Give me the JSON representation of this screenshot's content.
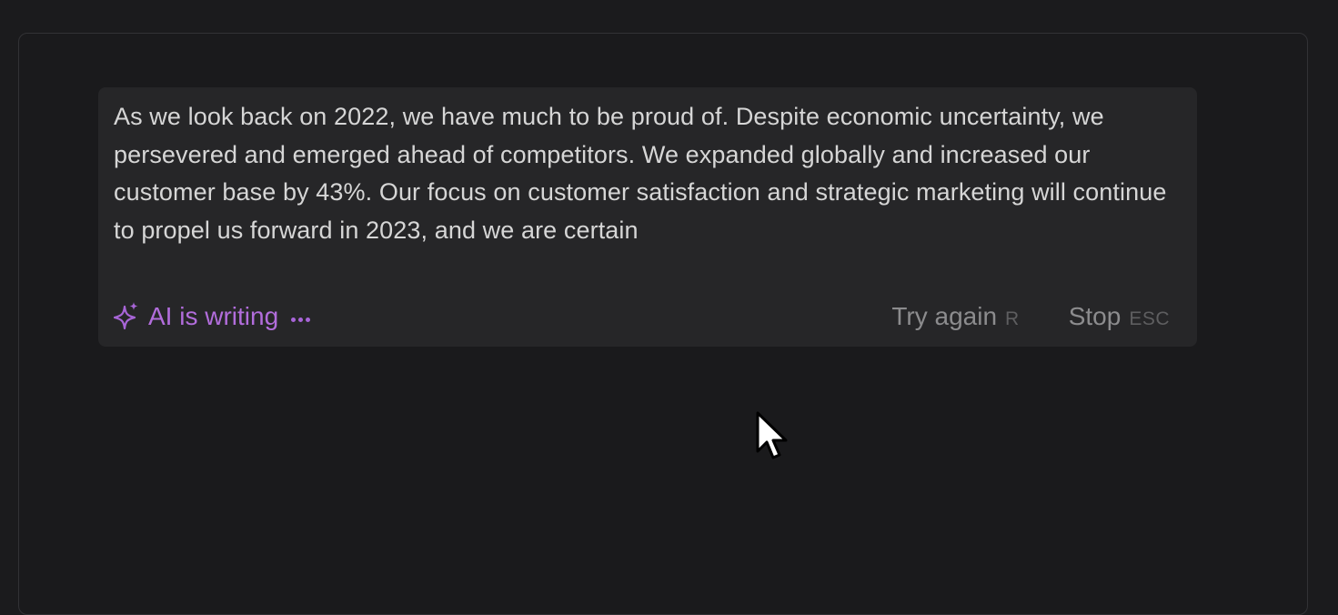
{
  "ai_block": {
    "generated_text": "As we look back on 2022, we have much to be proud of. Despite economic uncertainty, we persevered and emerged ahead of competitors. We expanded globally and increased our customer base by 43%. Our focus on customer satisfaction and strategic marketing will continue to propel us forward in 2023, and we are certain",
    "status": {
      "icon": "sparkle-icon",
      "label": "AI is writing",
      "indicator": "dots-icon"
    },
    "actions": {
      "try_again": {
        "label": "Try again",
        "shortcut": "R"
      },
      "stop": {
        "label": "Stop",
        "shortcut": "ESC"
      }
    }
  },
  "colors": {
    "accent": "#b26ddc",
    "text": "#d6d6d6",
    "muted": "#8c8c8e",
    "panel": "#262628",
    "background": "#1b1b1d"
  },
  "cursor": {
    "icon": "mouse-pointer-icon"
  }
}
